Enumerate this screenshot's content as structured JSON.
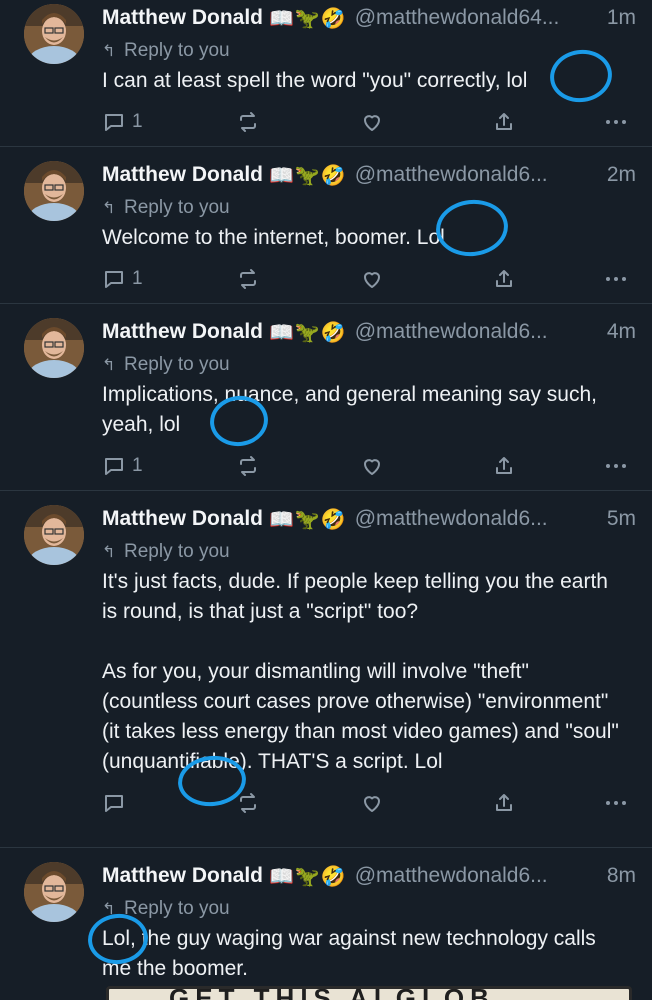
{
  "posts": [
    {
      "name": "Matthew Donald",
      "emojis": "📖🦖🤣",
      "handle": "@matthewdonald64...",
      "time": "1m",
      "reply_to": "Reply to you",
      "text": "I can at least spell the word \"you\" correctly, lol",
      "reply_count": "1"
    },
    {
      "name": "Matthew Donald",
      "emojis": "📖🦖🤣",
      "handle": "@matthewdonald6...",
      "time": "2m",
      "reply_to": "Reply to you",
      "text": "Welcome to the internet, boomer. Lol",
      "reply_count": "1"
    },
    {
      "name": "Matthew Donald",
      "emojis": "📖🦖🤣",
      "handle": "@matthewdonald6...",
      "time": "4m",
      "reply_to": "Reply to you",
      "text": "Implications, nuance, and general meaning say such, yeah, lol",
      "reply_count": "1"
    },
    {
      "name": "Matthew Donald",
      "emojis": "📖🦖🤣",
      "handle": "@matthewdonald6...",
      "time": "5m",
      "reply_to": "Reply to you",
      "text": "It's just facts, dude. If people keep telling you the earth is round, is that just a \"script\" too?\n\nAs for you, your dismantling will involve \"theft\" (countless court cases prove otherwise) \"environment\" (it takes less energy than most video games) and \"soul\" (unquantifiable). THAT'S a script. Lol",
      "reply_count": ""
    },
    {
      "name": "Matthew Donald",
      "emojis": "📖🦖🤣",
      "handle": "@matthewdonald6...",
      "time": "8m",
      "reply_to": "Reply to you",
      "text": "Lol, the guy waging war against new technology calls me the boomer.",
      "reply_count": ""
    }
  ],
  "embedded_image_text": "GET THIS ALGLOB",
  "colors": {
    "background": "#161e27",
    "muted": "#8b98a5",
    "annotation": "#1a9be8"
  }
}
